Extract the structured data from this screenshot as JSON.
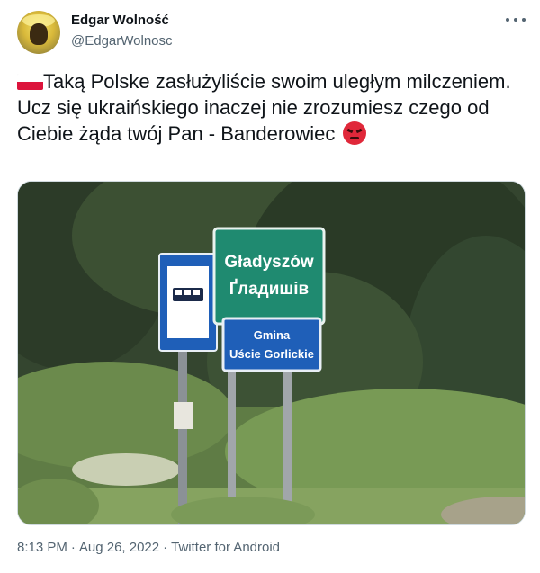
{
  "author": {
    "name": "Edgar Wolność",
    "handle": "@EdgarWolnosc"
  },
  "tweet": {
    "text": "Taką Polske zasłużyliście swoim uległym milczeniem. Ucz się ukraińskiego inaczej nie zrozumiesz czego od Ciebie żąda twój Pan - Banderowiec ",
    "leading_emoji": "flag-poland-icon",
    "trailing_emoji": "angry-face-icon"
  },
  "media": {
    "sign_green_line1": "Gładyszów",
    "sign_green_line2": "Ґладишів",
    "sign_blue_line1": "Gmina",
    "sign_blue_line2": "Uście Gorlickie"
  },
  "footer": {
    "time": "8:13 PM",
    "separator": "·",
    "date": "Aug 26, 2022",
    "source": "Twitter for Android"
  },
  "colors": {
    "text": "#0f1419",
    "secondary": "#536471",
    "sign_green": "#1f8a70",
    "sign_blue": "#1f5fb8"
  }
}
